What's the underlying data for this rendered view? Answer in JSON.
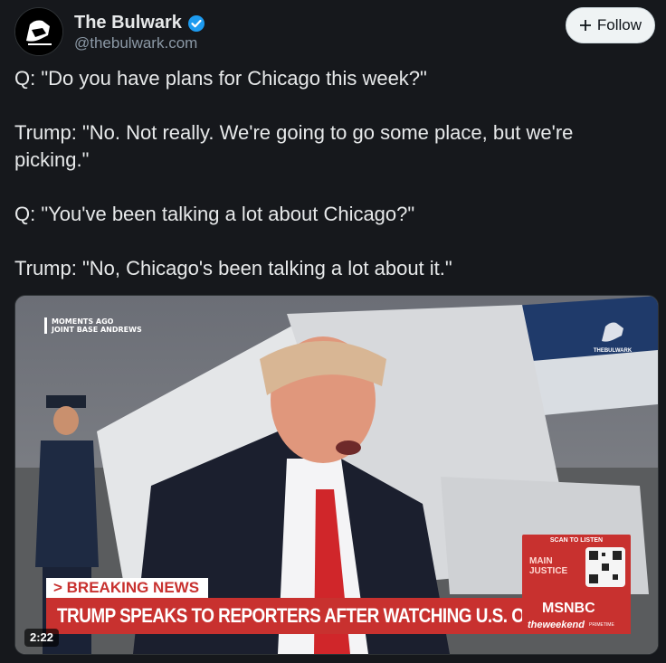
{
  "account": {
    "display_name": "The Bulwark",
    "handle": "@thebulwark.com",
    "verified_icon": "verified-check-icon",
    "follow_label": "Follow",
    "follow_icon": "plus-icon"
  },
  "post": {
    "paragraphs": [
      "Q: \"Do you have plans for Chicago this week?\"",
      "Trump: \"No. Not really. We're going to go some place, but we're picking.\"",
      "Q: \"You've been talking a lot about Chicago?\"",
      "Trump: \"No, Chicago's been talking a lot about it.\""
    ]
  },
  "video": {
    "duration": "2:22",
    "overlay": {
      "moments_line1": "MOMENTS AGO",
      "moments_line2": "JOINT BASE ANDREWS",
      "watermark": "THEBULWARK",
      "scan_label": "SCAN TO LISTEN",
      "podcast_line1": "MAIN",
      "podcast_line2": "JUSTICE",
      "breaking": "> BREAKING NEWS",
      "headline": "TRUMP SPEAKS TO REPORTERS AFTER WATCHING U.S. OPEN",
      "network": "MSNBC",
      "show": "theweekend",
      "show_sub": "PRIMETIME"
    }
  },
  "colors": {
    "background": "#16181c",
    "text": "#e7e9ea",
    "muted": "#8b98a5",
    "verified": "#1d9bf0",
    "news_red": "#c8312f"
  }
}
